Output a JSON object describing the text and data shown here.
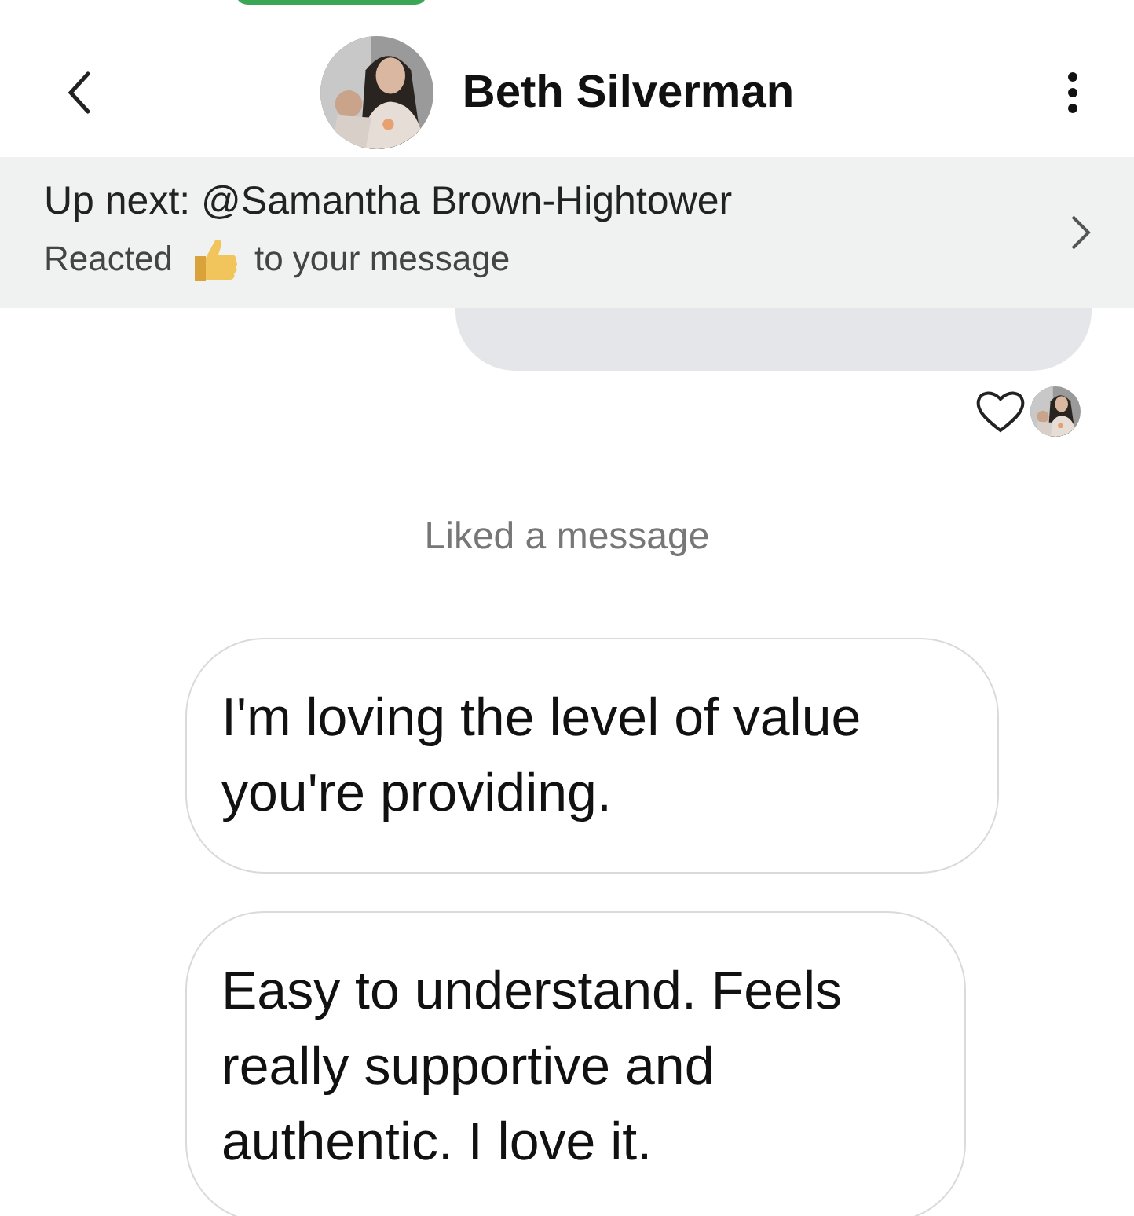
{
  "header": {
    "contact_name": "Beth Silverman"
  },
  "up_next": {
    "title": "Up next: @Samantha Brown-Hightower",
    "reacted_label": "Reacted",
    "reacted_suffix": "to your message"
  },
  "activity_label": "Liked a message",
  "messages": [
    {
      "text": "I'm loving the level of value you're providing."
    },
    {
      "text": "Easy to understand. Feels really supportive and authentic. I love it."
    }
  ]
}
